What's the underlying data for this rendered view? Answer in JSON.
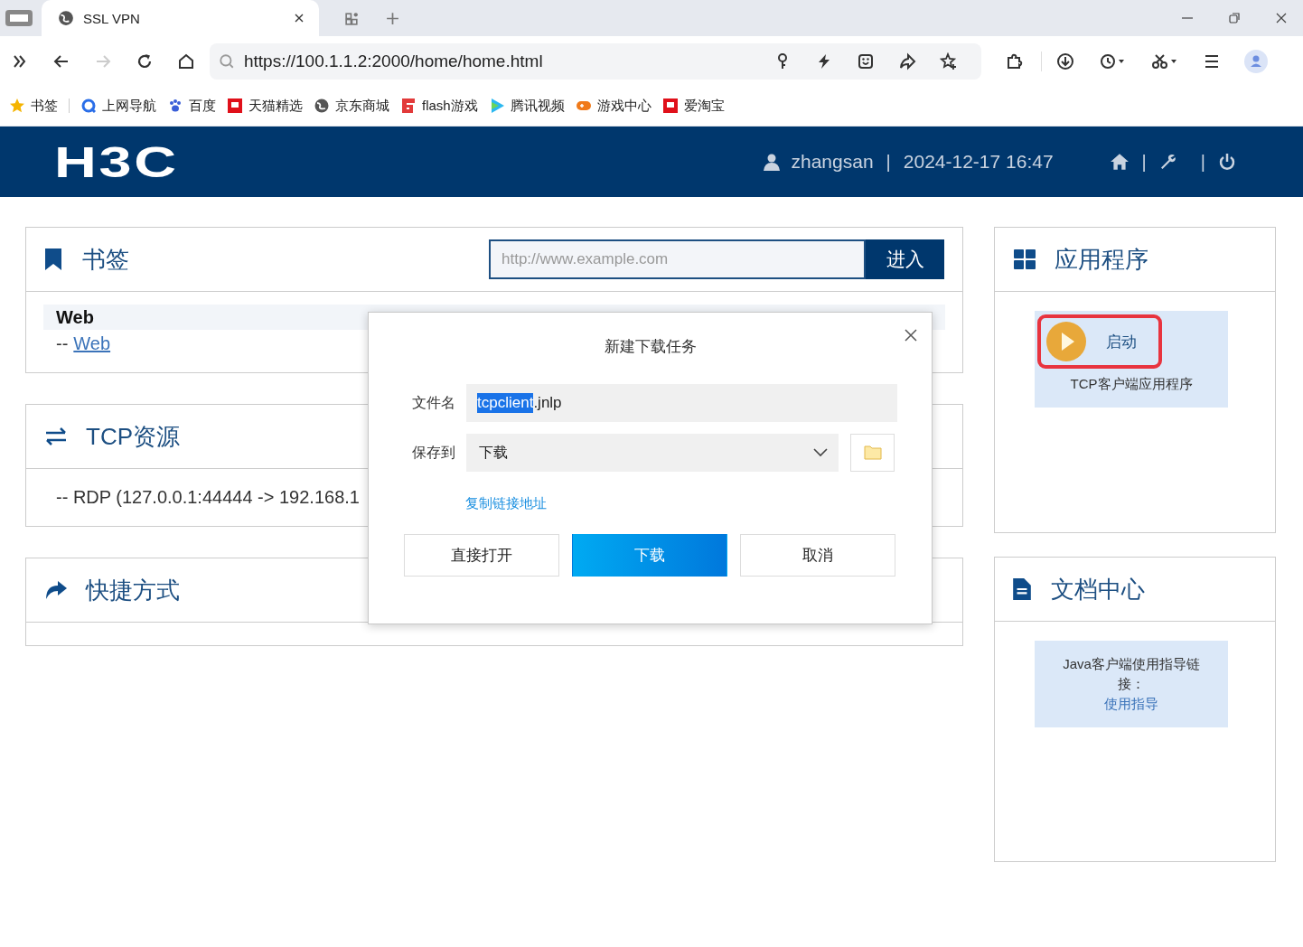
{
  "browser": {
    "tabs": [
      {
        "title": "SSL VPN",
        "selected": true
      }
    ],
    "url": "https://100.1.1.2:2000/home/home.html",
    "bookmarks": [
      {
        "label": "书签",
        "kind": "star"
      },
      {
        "label": "上网导航",
        "kind": "search"
      },
      {
        "label": "百度",
        "kind": "paw"
      },
      {
        "label": "天猫精选",
        "kind": "square-logo"
      },
      {
        "label": "京东商城",
        "kind": "globe"
      },
      {
        "label": "flash游戏",
        "kind": "frame-logo"
      },
      {
        "label": "腾讯视频",
        "kind": "play"
      },
      {
        "label": "游戏中心",
        "kind": "gamepad"
      },
      {
        "label": "爱淘宝",
        "kind": "square-logo"
      }
    ]
  },
  "header": {
    "logo": "H3C",
    "user": "zhangsan",
    "separators": [
      "|",
      "|",
      "|"
    ],
    "datetime": "2024-12-17 16:47"
  },
  "bookmarks_panel": {
    "title": "书签",
    "url_field": {
      "placeholder": "http://www.example.com"
    },
    "go_button": "进入",
    "groups": [
      {
        "name": "Web",
        "links": [
          {
            "prefix": "--",
            "label": "Web"
          }
        ]
      }
    ]
  },
  "tcp_panel": {
    "title": "TCP资源",
    "items": [
      "-- RDP (127.0.0.1:44444 -> 192.168.1"
    ]
  },
  "shortcuts_panel": {
    "title": "快捷方式"
  },
  "apps_panel": {
    "title": "应用程序",
    "apps": [
      {
        "button": "启动",
        "name": "TCP客户端应用程序",
        "highlighted": true
      }
    ]
  },
  "docs_panel": {
    "title": "文档中心",
    "docs": [
      {
        "text": "Java客户端使用指导链接：",
        "link": "使用指导"
      }
    ]
  },
  "dialog": {
    "title": "新建下载任务",
    "filename_label": "文件名",
    "filename_selected": "tcpclient",
    "filename_rest": ".jnlp",
    "save_label": "保存到",
    "folder": "下载",
    "copy_link": "复制链接地址",
    "buttons": [
      {
        "label": "直接打开",
        "kind": "default"
      },
      {
        "label": "下载",
        "kind": "primary"
      },
      {
        "label": "取消",
        "kind": "default"
      }
    ]
  }
}
